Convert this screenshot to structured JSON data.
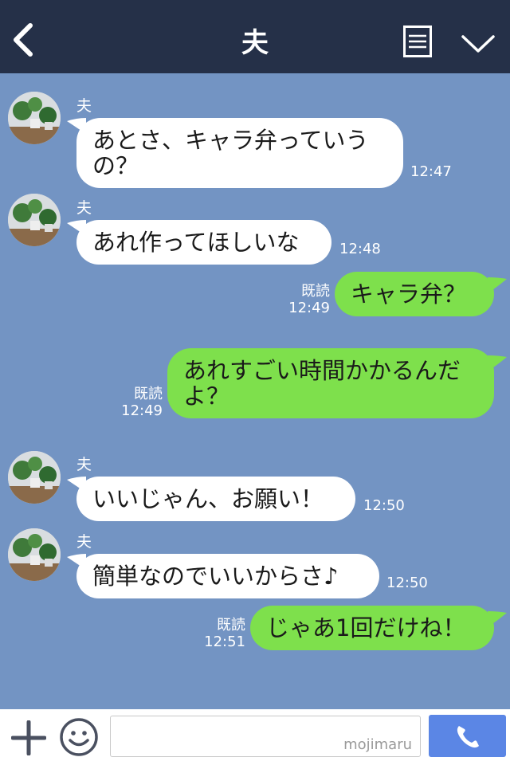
{
  "header": {
    "title": "夫"
  },
  "messages": [
    {
      "side": "in",
      "sender": "夫",
      "lines": [
        "あとさ、キャラ弁っていう",
        "の？"
      ],
      "time": "12:47"
    },
    {
      "side": "in",
      "sender": "夫",
      "lines": [
        "あれ作ってほしいな"
      ],
      "time": "12:48"
    },
    {
      "side": "out",
      "read": "既読",
      "lines": [
        "キャラ弁？"
      ],
      "time": "12:49"
    },
    {
      "side": "out",
      "read": "既読",
      "lines": [
        "あれすごい時間かかるんだ",
        "よ？"
      ],
      "time": "12:49"
    },
    {
      "side": "in",
      "sender": "夫",
      "lines": [
        "いいじゃん、お願い！"
      ],
      "time": "12:50"
    },
    {
      "side": "in",
      "sender": "夫",
      "lines": [
        "簡単なのでいいからさ♪"
      ],
      "time": "12:50"
    },
    {
      "side": "out",
      "read": "既読",
      "lines": [
        "じゃあ1回だけね！"
      ],
      "time": "12:51"
    }
  ],
  "input": {
    "watermark": "mojimaru"
  },
  "colors": {
    "background": "#7394c3",
    "header": "#253048",
    "outgoing": "#7ee04c",
    "incoming": "#ffffff",
    "call_button": "#5b86e5"
  }
}
